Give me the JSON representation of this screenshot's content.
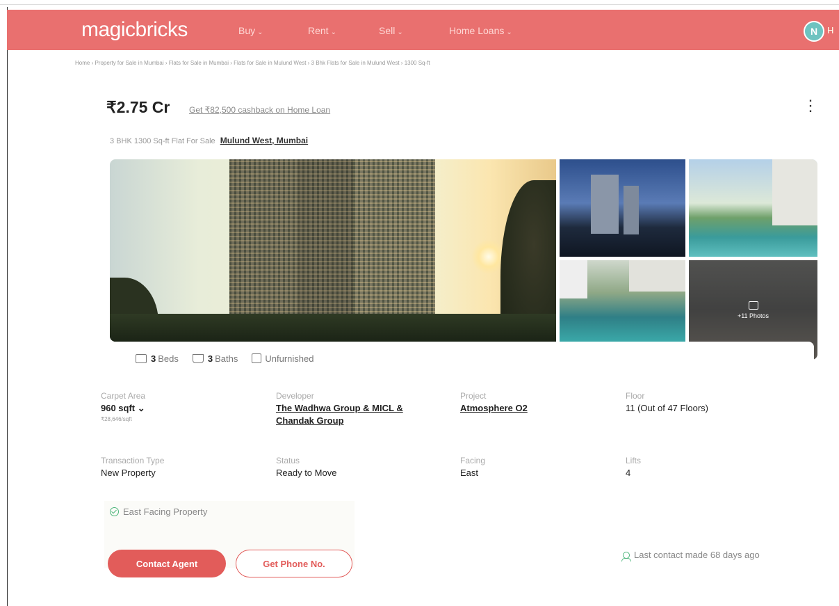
{
  "header": {
    "logo": "magicbricks",
    "nav": [
      {
        "label": "Buy"
      },
      {
        "label": "Rent"
      },
      {
        "label": "Sell"
      },
      {
        "label": "Home Loans"
      }
    ],
    "avatar_initial": "N",
    "avatar_tail": "H"
  },
  "breadcrumb": [
    "Home",
    "Property for Sale in Mumbai",
    "Flats for Sale in Mumbai",
    "Flats for Sale in Mulund West",
    "3 Bhk Flats for Sale in Mulund West",
    "1300 Sq-ft"
  ],
  "listing": {
    "price": "₹2.75 Cr",
    "cashback": "Get ₹82,500 cashback on Home Loan",
    "subtitle": "3 BHK 1300 Sq-ft Flat For Sale",
    "location": "Mulund West, Mumbai",
    "more_photos": "+11 Photos",
    "features": {
      "beds_count": "3",
      "beds_label": "Beds",
      "baths_count": "3",
      "baths_label": "Baths",
      "furnishing": "Unfurnished"
    },
    "details": {
      "carpet_area_label": "Carpet Area",
      "carpet_area_value": "960 sqft",
      "carpet_area_rate": "₹28,646/sqft",
      "developer_label": "Developer",
      "developer_value": "The Wadhwa Group & MICL & Chandak Group",
      "project_label": "Project",
      "project_value": "Atmosphere O2",
      "floor_label": "Floor",
      "floor_value": "11 (Out of 47 Floors)",
      "transaction_label": "Transaction Type",
      "transaction_value": "New Property",
      "status_label": "Status",
      "status_value": "Ready to Move",
      "facing_label": "Facing",
      "facing_value": "East",
      "lifts_label": "Lifts",
      "lifts_value": "4"
    },
    "highlight": "East Facing Property",
    "contact_agent": "Contact Agent",
    "get_phone": "Get Phone No.",
    "last_contact": "Last contact made 68 days ago"
  },
  "colors": {
    "brand": "#e9706f",
    "button": "#e25c5a",
    "success": "#4cb57a"
  }
}
